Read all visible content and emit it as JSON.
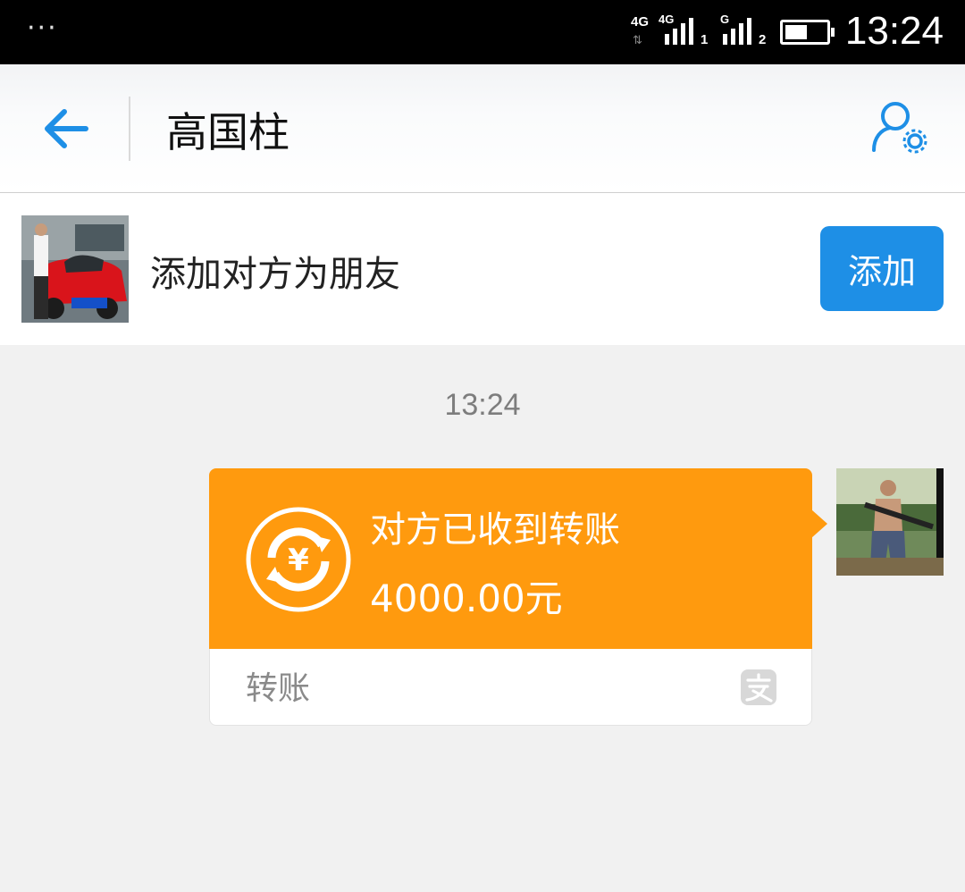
{
  "status_bar": {
    "overflow_dots": "···",
    "network_1": "4G",
    "network_2": "4G",
    "sim_1": "1",
    "network_3": "G",
    "sim_2": "2",
    "battery_level": 0.55,
    "time": "13:24"
  },
  "header": {
    "title": "高国柱"
  },
  "add_friend": {
    "prompt": "添加对方为朋友",
    "button_label": "添加"
  },
  "chat": {
    "timestamp": "13:24",
    "transfer": {
      "status": "对方已收到转账",
      "amount": "4000.00元",
      "footer_label": "转账"
    }
  },
  "colors": {
    "accent_blue": "#1e8fe6",
    "transfer_orange": "#ff9a0e",
    "background": "#f1f1f1"
  }
}
